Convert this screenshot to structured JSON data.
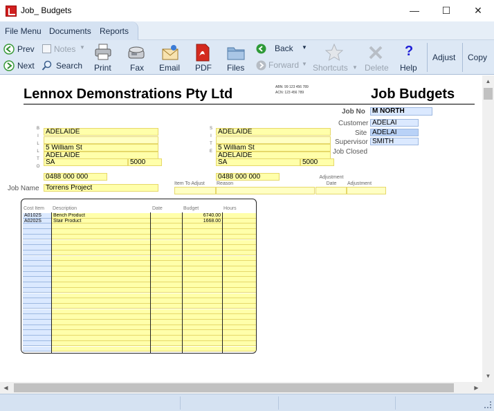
{
  "window": {
    "title": "Job_ Budgets",
    "minimize": "—",
    "maximize": "☐",
    "close": "✕"
  },
  "menu": {
    "file": "File Menu",
    "documents": "Documents",
    "reports": "Reports"
  },
  "toolbar": {
    "prev": "Prev",
    "next": "Next",
    "notes": "Notes",
    "search": "Search",
    "print": "Print",
    "fax": "Fax",
    "email": "Email",
    "pdf": "PDF",
    "files": "Files",
    "back": "Back",
    "forward": "Forward",
    "shortcuts": "Shortcuts",
    "delete": "Delete",
    "help": "Help",
    "adjust": "Adjust",
    "copy": "Copy"
  },
  "doc": {
    "company": "Lennox Demonstrations Pty Ltd",
    "title": "Job Budgets",
    "abn": "ABN: 99 123 456 789",
    "acn": "ACN: 123 456 789",
    "job_no_label": "Job No",
    "job_no": "M NORTH",
    "customer_label": "Customer",
    "customer": "ADELAI",
    "site_label": "Site",
    "site": "ADELAI",
    "supervisor_label": "Supervisor",
    "supervisor": "SMITH",
    "job_closed_label": "Job Closed",
    "bill_to_letters": [
      "B",
      "I",
      "L",
      "L",
      "",
      "T",
      "O"
    ],
    "site_letters": [
      "S",
      "I",
      "T",
      "E"
    ],
    "bill_to": {
      "line1": "ADELAIDE",
      "line2": "",
      "line3": "5 William St",
      "line4": "ADELAIDE",
      "state": "SA",
      "postcode": "5000",
      "phone": "0488 000 000"
    },
    "site_addr": {
      "line1": "ADELAIDE",
      "line2": "",
      "line3": "5 William St",
      "line4": "ADELAIDE",
      "state": "SA",
      "postcode": "5000",
      "phone": "0488 000 000"
    },
    "job_name_label": "Job Name",
    "job_name": "Torrens Project",
    "item_to_adjust_label": "Item To Adjust",
    "reason_label": "Reason",
    "adjustment_date_label": "Adjustment\nDate",
    "adjustment_label": "Adjustment"
  },
  "table": {
    "headers": [
      "Cost Item",
      "Description",
      "Date",
      "Budget",
      "Hours"
    ],
    "rows": [
      {
        "cost_item": "A0102S",
        "description": "Bench Product",
        "date": "",
        "budget": "6740.00",
        "hours": ""
      },
      {
        "cost_item": "A0202S",
        "description": "Stair Product",
        "date": "",
        "budget": "1668.00",
        "hours": ""
      }
    ],
    "row_count": 26
  }
}
